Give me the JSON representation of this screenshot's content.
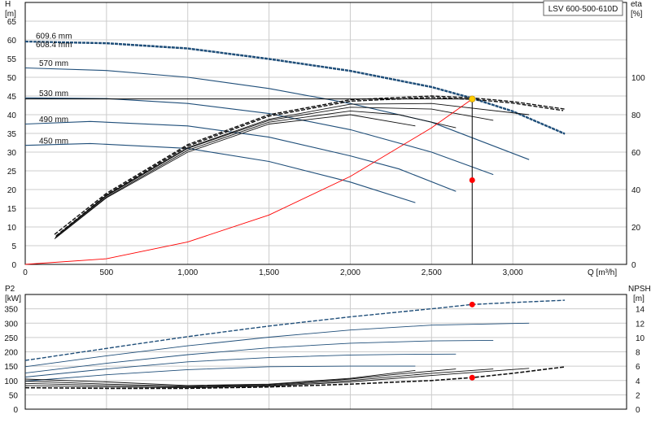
{
  "header": {
    "model_label": "LSV 600-500-610D"
  },
  "colors": {
    "head_curves": "#1f4e79",
    "efficiency_curves": "#111111",
    "system_curve": "#ff0000",
    "duty_point_head": "#ffcc00",
    "duty_point_marker": "#ff0000",
    "grid": "#cccccc"
  },
  "chart_data": [
    {
      "type": "line",
      "title": "",
      "xlabel": "Q [m³/h]",
      "ylabel": "H [m]",
      "y2label": "eta [%]",
      "xlim": [
        0,
        3700
      ],
      "ylim": [
        0,
        70
      ],
      "y2lim": [
        0,
        140
      ],
      "x_ticks": [
        "0",
        "500",
        "1,000",
        "1,500",
        "2,000",
        "2,500",
        "3,000"
      ],
      "y_ticks": [
        "0",
        "5",
        "10",
        "15",
        "20",
        "25",
        "30",
        "35",
        "40",
        "45",
        "50",
        "55",
        "60",
        "65"
      ],
      "y2_ticks": [
        "0",
        "20",
        "40",
        "60",
        "80",
        "100"
      ],
      "grid": true,
      "head_series": [
        {
          "name": "609.6 mm",
          "x": [
            0,
            500,
            1000,
            1500,
            2000,
            2500,
            2750,
            3000,
            3320
          ],
          "y": [
            59.6,
            59.2,
            57.8,
            55.0,
            51.8,
            47.5,
            44.5,
            41.0,
            35.0
          ]
        },
        {
          "name": "608.4 mm",
          "x": [
            0,
            500,
            1000,
            1500,
            2000,
            2500,
            2750,
            3000,
            3320
          ],
          "y": [
            59.5,
            59.0,
            57.6,
            54.8,
            51.6,
            47.3,
            44.3,
            40.8,
            34.8
          ]
        },
        {
          "name": "570 mm",
          "x": [
            0,
            500,
            1000,
            1500,
            2000,
            2500,
            3100
          ],
          "y": [
            52.5,
            51.8,
            50.0,
            47.0,
            43.0,
            38.0,
            28.0
          ]
        },
        {
          "name": "530 mm",
          "x": [
            0,
            500,
            1000,
            1500,
            2000,
            2500,
            2880
          ],
          "y": [
            44.5,
            44.3,
            43.0,
            40.3,
            36.0,
            30.0,
            24.0
          ]
        },
        {
          "name": "490 mm",
          "x": [
            0,
            400,
            1000,
            1500,
            2000,
            2300,
            2650
          ],
          "y": [
            37.5,
            38.2,
            37.0,
            34.0,
            29.0,
            25.5,
            19.5
          ]
        },
        {
          "name": "450 mm",
          "x": [
            0,
            400,
            1000,
            1500,
            2000,
            2400
          ],
          "y": [
            31.8,
            32.3,
            31.0,
            27.5,
            22.0,
            16.5
          ]
        }
      ],
      "efficiency_series": [
        {
          "name": "609.6 mm",
          "x": [
            180,
            500,
            1000,
            1500,
            2000,
            2500,
            2750,
            3000,
            3320
          ],
          "y": [
            8,
            19,
            32,
            40,
            44,
            45,
            44.5,
            43.5,
            41.5
          ]
        },
        {
          "name": "608.4 mm",
          "x": [
            190,
            500,
            1000,
            1500,
            2000,
            2500,
            2750,
            3000,
            3310
          ],
          "y": [
            7.6,
            18.6,
            31.6,
            39.6,
            43.6,
            44.6,
            44.1,
            43.1,
            41.1
          ]
        },
        {
          "name": "570 mm",
          "x": [
            190,
            500,
            1000,
            1500,
            2000,
            2500,
            3100
          ],
          "y": [
            7.5,
            18.5,
            31.2,
            38.8,
            42.8,
            43.0,
            40.0
          ]
        },
        {
          "name": "530 mm",
          "x": [
            185,
            500,
            1000,
            1500,
            2000,
            2500,
            2880
          ],
          "y": [
            7.2,
            18.3,
            31.0,
            38.5,
            42.0,
            41.5,
            38.5
          ]
        },
        {
          "name": "490 mm",
          "x": [
            185,
            500,
            1000,
            1500,
            2000,
            2300,
            2650
          ],
          "y": [
            7.0,
            18.0,
            30.5,
            38.0,
            41.0,
            40.0,
            36.5
          ]
        },
        {
          "name": "450 mm",
          "x": [
            180,
            500,
            1000,
            1500,
            2000,
            2400
          ],
          "y": [
            6.8,
            17.8,
            30.0,
            37.5,
            40.0,
            37.0
          ]
        }
      ],
      "system_curve": {
        "x": [
          0,
          500,
          1000,
          1500,
          2000,
          2500,
          2750
        ],
        "y": [
          0,
          1.5,
          6,
          13.2,
          23.5,
          36.5,
          44.2
        ]
      },
      "duty_point": {
        "x": 2750,
        "head": 44.2,
        "eta": 45
      }
    },
    {
      "type": "line",
      "title": "",
      "xlabel": "",
      "ylabel": "P2 [kW]",
      "y2label": "NPSH [m]",
      "xlim": [
        0,
        3700
      ],
      "ylim": [
        0,
        400
      ],
      "y2lim": [
        0,
        16
      ],
      "y_ticks": [
        "0",
        "50",
        "100",
        "150",
        "200",
        "250",
        "300",
        "350"
      ],
      "y2_ticks": [
        "0",
        "2",
        "4",
        "6",
        "8",
        "10",
        "12",
        "14"
      ],
      "grid": true,
      "power_series": [
        {
          "name": "609.6 mm",
          "x": [
            0,
            500,
            1000,
            1500,
            2000,
            2500,
            2750,
            3000,
            3320
          ],
          "y": [
            170,
            212,
            253,
            290,
            322,
            350,
            365,
            372,
            380
          ]
        },
        {
          "name": "570 mm",
          "x": [
            0,
            500,
            1000,
            1500,
            2000,
            2500,
            3100
          ],
          "y": [
            148,
            186,
            221,
            251,
            276,
            293,
            300
          ]
        },
        {
          "name": "530 mm",
          "x": [
            0,
            500,
            1000,
            1500,
            2000,
            2500,
            2880
          ],
          "y": [
            126,
            160,
            190,
            214,
            230,
            238,
            240
          ]
        },
        {
          "name": "490 mm",
          "x": [
            0,
            500,
            1000,
            1500,
            2000,
            2300,
            2650
          ],
          "y": [
            112,
            140,
            165,
            180,
            189,
            191,
            192
          ]
        },
        {
          "name": "450 mm",
          "x": [
            0,
            500,
            1000,
            1500,
            2000,
            2400
          ],
          "y": [
            98,
            120,
            138,
            148,
            150,
            150
          ]
        }
      ],
      "npsh_series": [
        {
          "name": "609.6 mm",
          "x": [
            0,
            500,
            1000,
            1500,
            2000,
            2500,
            2750,
            3000,
            3320
          ],
          "y": [
            3.0,
            2.9,
            2.9,
            3.1,
            3.5,
            4.0,
            4.4,
            5.0,
            5.9
          ]
        },
        {
          "name": "570 mm",
          "x": [
            0,
            500,
            1000,
            1500,
            2000,
            2500,
            3100
          ],
          "y": [
            3.3,
            3.1,
            3.0,
            3.2,
            3.8,
            4.7,
            5.7
          ]
        },
        {
          "name": "530 mm",
          "x": [
            0,
            500,
            1000,
            1500,
            2000,
            2500,
            2880
          ],
          "y": [
            3.6,
            3.3,
            3.1,
            3.3,
            4.0,
            5.0,
            5.6
          ]
        },
        {
          "name": "490 mm",
          "x": [
            0,
            500,
            1000,
            1500,
            2000,
            2300,
            2650
          ],
          "y": [
            3.9,
            3.5,
            3.2,
            3.4,
            4.2,
            4.9,
            5.6
          ]
        },
        {
          "name": "450 mm",
          "x": [
            0,
            500,
            1000,
            1500,
            2000,
            2400
          ],
          "y": [
            4.2,
            3.8,
            3.3,
            3.5,
            4.3,
            5.4
          ]
        }
      ],
      "duty_point": {
        "x": 2750,
        "power": 365,
        "npsh": 4.4
      }
    }
  ]
}
